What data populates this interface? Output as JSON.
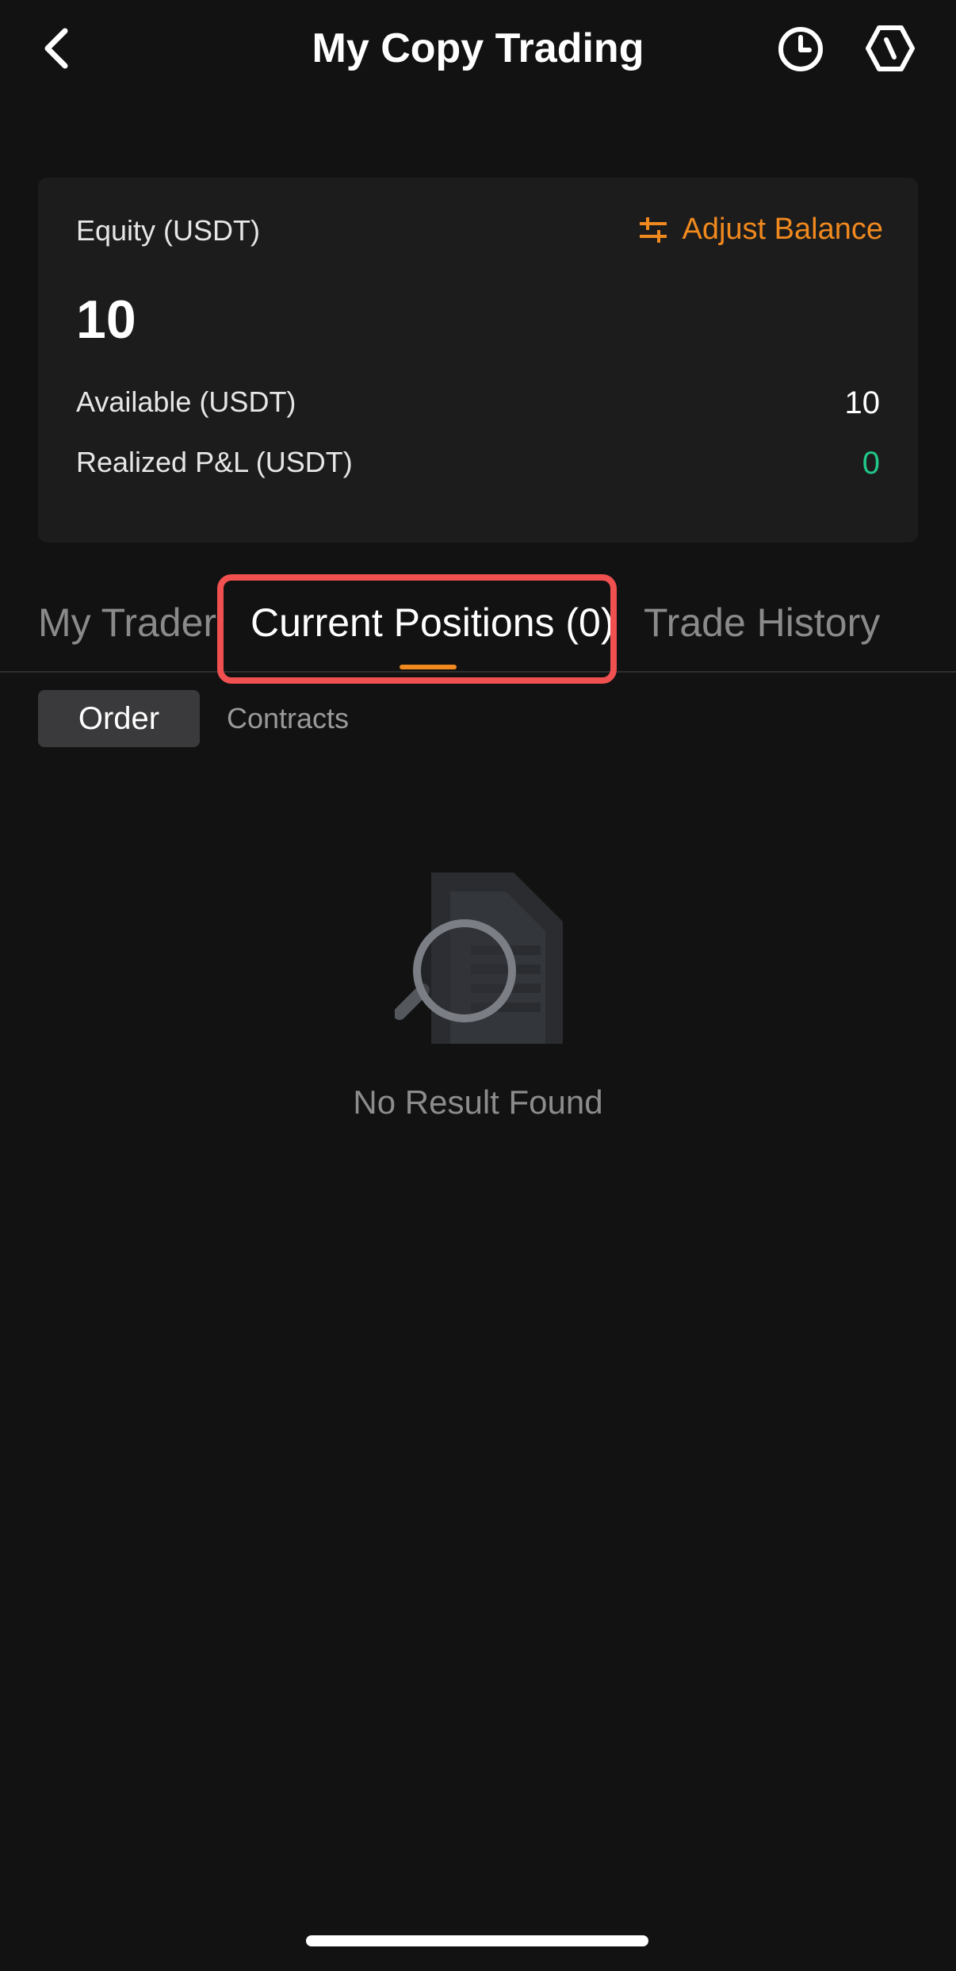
{
  "header": {
    "title": "My Copy Trading",
    "back_icon": "chevron-left-icon",
    "history_icon": "clock-icon",
    "settings_icon": "hexagon-settings-icon"
  },
  "account": {
    "equity_label": "Equity (USDT)",
    "equity_value": "10",
    "adjust_balance_label": "Adjust Balance",
    "adjust_icon": "sliders-icon",
    "available_label": "Available (USDT)",
    "available_value": "10",
    "realized_pnl_label": "Realized P&L (USDT)",
    "realized_pnl_value": "0"
  },
  "tabs": [
    {
      "label": "My Trader",
      "active": false
    },
    {
      "label": "Current Positions (0)",
      "active": true
    },
    {
      "label": "Trade History",
      "active": false
    }
  ],
  "subtabs": [
    {
      "label": "Order",
      "active": true
    },
    {
      "label": "Contracts",
      "active": false
    }
  ],
  "empty_state": {
    "icon": "document-search-icon",
    "message": "No Result Found"
  },
  "colors": {
    "background": "#121212",
    "card": "#1c1c1c",
    "accent": "#f0891e",
    "positive": "#20c787",
    "highlight": "#f05050"
  }
}
